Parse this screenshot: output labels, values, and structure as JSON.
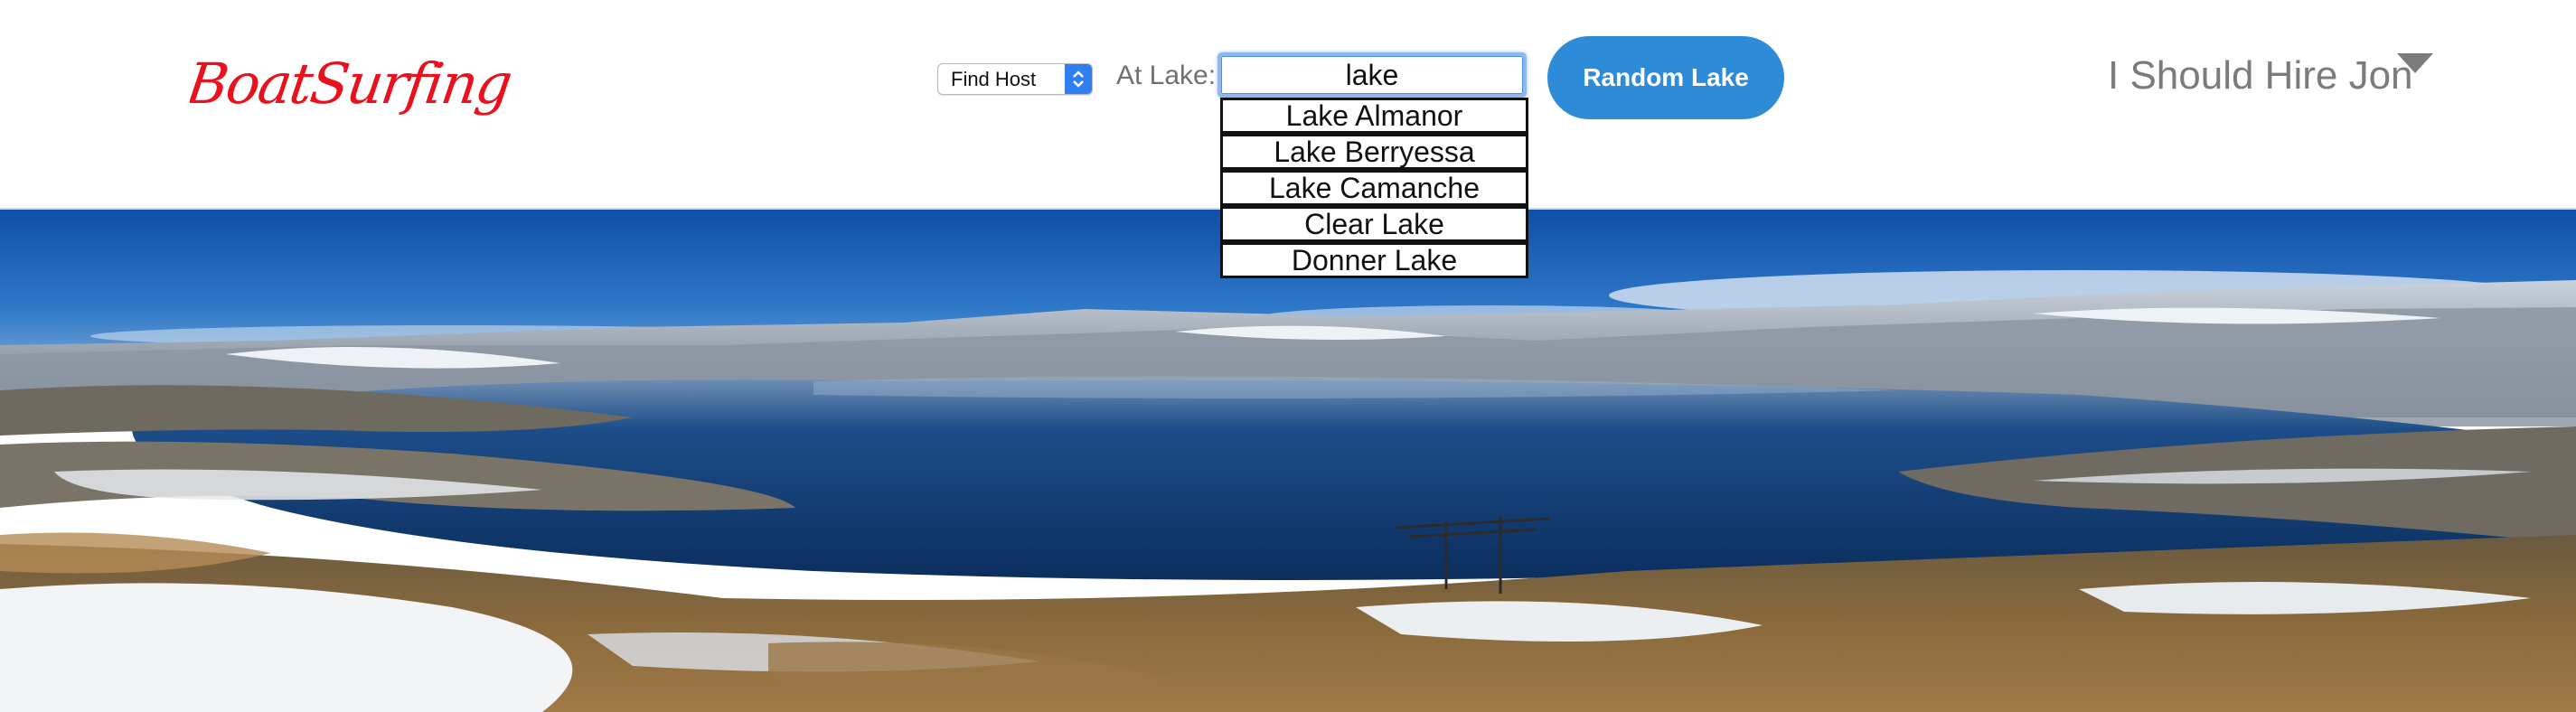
{
  "brand": {
    "name": "BoatSurfing",
    "color": "#e8111d"
  },
  "search": {
    "mode_value": "Find Host",
    "lake_label": "At Lake:",
    "lake_query": "lake",
    "suggestions": [
      "Lake Almanor",
      "Lake Berryessa",
      "Lake Camanche",
      "Clear Lake",
      "Donner Lake"
    ]
  },
  "random_button": {
    "label": "Random Lake",
    "color": "#2d8bd8"
  },
  "user_menu": {
    "label": "I Should Hire Jon",
    "icon": "caret-down-icon"
  },
  "hero": {
    "description_icon": "lake-photo"
  }
}
